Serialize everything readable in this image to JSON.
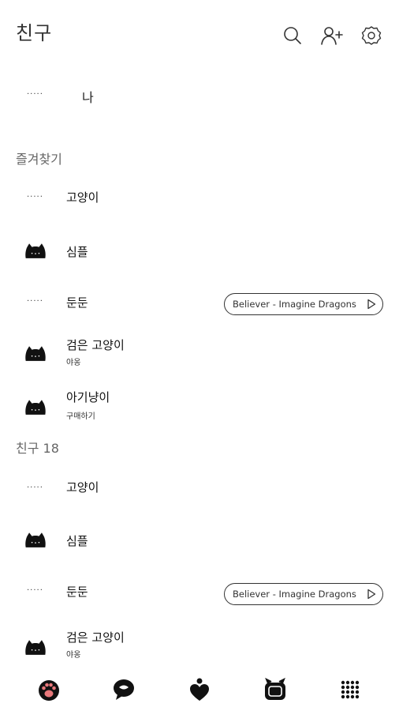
{
  "header": {
    "title": "친구",
    "icons": [
      "search-icon",
      "add-friend-icon",
      "settings-icon"
    ]
  },
  "my_profile": {
    "name": "나",
    "avatar_text": "·····"
  },
  "favorites": {
    "label": "즐겨찾기",
    "items": [
      {
        "name": "고양이",
        "status": "",
        "avatar": "dots",
        "music": ""
      },
      {
        "name": "심플",
        "status": "",
        "avatar": "cat",
        "music": ""
      },
      {
        "name": "둔둔",
        "status": "",
        "avatar": "dots",
        "music": "Believer - Imagine Dragons"
      },
      {
        "name": "검은 고양이",
        "status": "야옹",
        "avatar": "cat",
        "music": ""
      },
      {
        "name": "아기냥이",
        "status": "구매하기",
        "avatar": "cat",
        "music": ""
      }
    ]
  },
  "friends": {
    "label": "친구 18",
    "items": [
      {
        "name": "고양이",
        "status": "",
        "avatar": "dots",
        "music": ""
      },
      {
        "name": "심플",
        "status": "",
        "avatar": "cat",
        "music": ""
      },
      {
        "name": "둔둔",
        "status": "",
        "avatar": "dots",
        "music": "Believer - Imagine Dragons"
      },
      {
        "name": "검은 고양이",
        "status": "야옹",
        "avatar": "cat",
        "music": ""
      }
    ]
  },
  "tabbar": {
    "tabs": [
      {
        "icon": "paw-icon",
        "active": true
      },
      {
        "icon": "chat-icon",
        "active": false
      },
      {
        "icon": "heart-icon",
        "active": false
      },
      {
        "icon": "tv-icon",
        "active": false
      },
      {
        "icon": "grid-icon",
        "active": false
      }
    ]
  },
  "colors": {
    "accent": "#e8787b",
    "text": "#222222",
    "muted": "#666666"
  }
}
